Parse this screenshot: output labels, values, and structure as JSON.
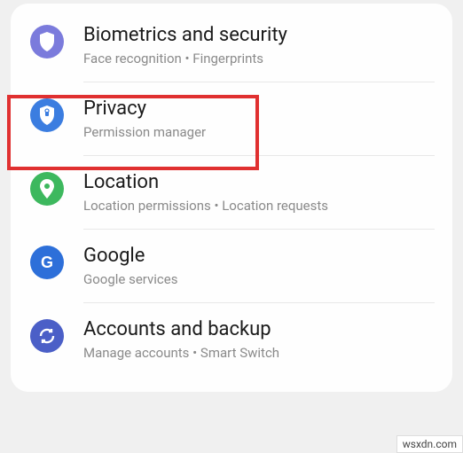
{
  "items": [
    {
      "title": "Biometrics and security",
      "subtitle": "Face recognition  •  Fingerprints"
    },
    {
      "title": "Privacy",
      "subtitle": "Permission manager"
    },
    {
      "title": "Location",
      "subtitle": "Location permissions  •  Location requests"
    },
    {
      "title": "Google",
      "subtitle": "Google services"
    },
    {
      "title": "Accounts and backup",
      "subtitle": "Manage accounts  •  Smart Switch"
    }
  ],
  "watermark": "wsxdn.com"
}
